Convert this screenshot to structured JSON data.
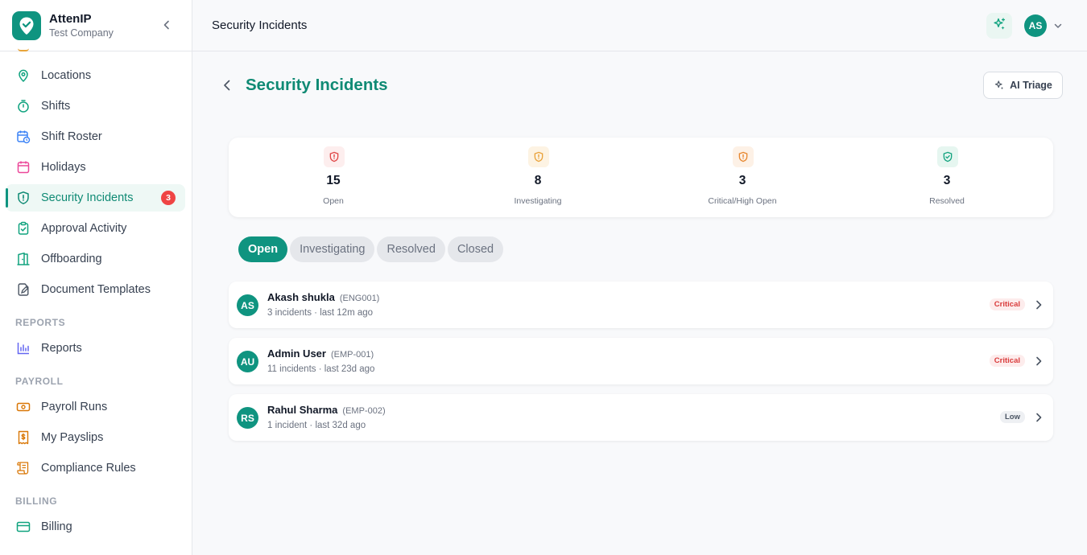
{
  "brand": {
    "name": "AttenIP",
    "company": "Test Company"
  },
  "sidebar": {
    "items": [
      {
        "label": "Locations",
        "icon": "map-pin-icon"
      },
      {
        "label": "Shifts",
        "icon": "stopwatch-icon"
      },
      {
        "label": "Shift Roster",
        "icon": "calendar-clock-icon"
      },
      {
        "label": "Holidays",
        "icon": "calendar-icon"
      },
      {
        "label": "Security Incidents",
        "icon": "shield-alert-icon",
        "badge": "3",
        "active": true
      },
      {
        "label": "Approval Activity",
        "icon": "clipboard-check-icon"
      },
      {
        "label": "Offboarding",
        "icon": "door-exit-icon"
      },
      {
        "label": "Document Templates",
        "icon": "file-edit-icon"
      }
    ],
    "sections": [
      {
        "label": "REPORTS",
        "items": [
          {
            "label": "Reports",
            "icon": "bar-chart-icon"
          }
        ]
      },
      {
        "label": "PAYROLL",
        "items": [
          {
            "label": "Payroll Runs",
            "icon": "banknote-icon"
          },
          {
            "label": "My Payslips",
            "icon": "receipt-dollar-icon"
          },
          {
            "label": "Compliance Rules",
            "icon": "scroll-icon"
          }
        ]
      },
      {
        "label": "BILLING",
        "items": [
          {
            "label": "Billing",
            "icon": "credit-card-icon"
          }
        ]
      }
    ]
  },
  "header": {
    "title": "Security Incidents",
    "user_initials": "AS"
  },
  "main": {
    "title": "Security Incidents",
    "triage_label": "AI Triage",
    "stats": [
      {
        "value": "15",
        "label": "Open",
        "color": "#e04848",
        "bg": "#fdeeee"
      },
      {
        "value": "8",
        "label": "Investigating",
        "color": "#e9a23b",
        "bg": "#fdf3e3"
      },
      {
        "value": "3",
        "label": "Critical/High Open",
        "color": "#e7872f",
        "bg": "#fdf1e6"
      },
      {
        "value": "3",
        "label": "Resolved",
        "color": "#12a37f",
        "bg": "#e6f6f0"
      }
    ],
    "tabs": [
      {
        "label": "Open",
        "active": true
      },
      {
        "label": "Investigating"
      },
      {
        "label": "Resolved"
      },
      {
        "label": "Closed"
      }
    ],
    "incidents": [
      {
        "initials": "AS",
        "name": "Akash shukla",
        "code": "(ENG001)",
        "meta": "3 incidents · last 12m ago",
        "severity": "Critical"
      },
      {
        "initials": "AU",
        "name": "Admin User",
        "code": "(EMP-001)",
        "meta": "11 incidents · last 23d ago",
        "severity": "Critical"
      },
      {
        "initials": "RS",
        "name": "Rahul Sharma",
        "code": "(EMP-002)",
        "meta": "1 incident · last 32d ago",
        "severity": "Low"
      }
    ]
  },
  "colors": {
    "accent": "#0f9480",
    "critical": "#d93b3b"
  }
}
